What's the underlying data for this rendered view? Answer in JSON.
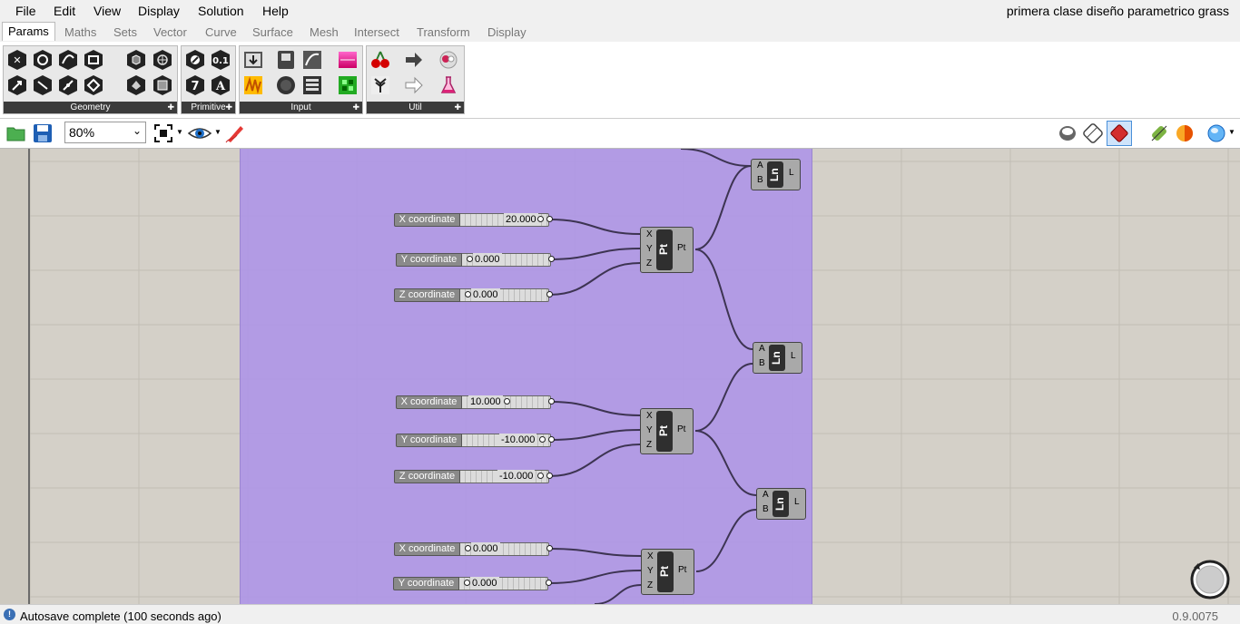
{
  "menu": [
    "File",
    "Edit",
    "View",
    "Display",
    "Solution",
    "Help"
  ],
  "window_title": "primera clase diseño parametrico grass",
  "tabs": [
    "Params",
    "Maths",
    "Sets",
    "Vector",
    "Curve",
    "Surface",
    "Mesh",
    "Intersect",
    "Transform",
    "Display"
  ],
  "ribbon": {
    "panels": [
      "Geometry",
      "Primitive",
      "Input",
      "Util"
    ]
  },
  "canvas_toolbar": {
    "zoom": "80%"
  },
  "sliders": [
    {
      "label": "X coordinate",
      "value": "20.000"
    },
    {
      "label": "Y coordinate",
      "value": "0.000"
    },
    {
      "label": "Z coordinate",
      "value": "0.000"
    },
    {
      "label": "X coordinate",
      "value": "10.000"
    },
    {
      "label": "Y coordinate",
      "value": "-10.000"
    },
    {
      "label": "Z coordinate",
      "value": "-10.000"
    },
    {
      "label": "X coordinate",
      "value": "0.000"
    },
    {
      "label": "Y coordinate",
      "value": "0.000"
    }
  ],
  "point_component": {
    "caption": "Pt",
    "inputs": [
      "X",
      "Y",
      "Z"
    ],
    "output": "Pt"
  },
  "line_component": {
    "caption": "Ln",
    "inputs": [
      "A",
      "B"
    ],
    "output": "L"
  },
  "status": {
    "message": "Autosave complete (100 seconds ago)",
    "version": "0.9.0075"
  }
}
